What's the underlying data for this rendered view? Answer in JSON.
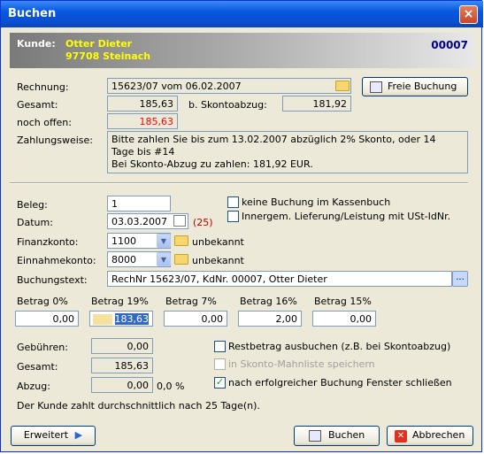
{
  "window": {
    "title": "Buchen",
    "close_symbol": "×"
  },
  "header": {
    "kunde_label": "Kunde:",
    "name": "Otter Dieter",
    "address": "97708 Steinach",
    "number": "00007"
  },
  "rechnung": {
    "label": "Rechnung:",
    "value": "15623/07 vom 06.02.2007",
    "gesamt_label": "Gesamt:",
    "gesamt": "185,63",
    "skonto_label": "b. Skontoabzug:",
    "skonto": "181,92",
    "offen_label": "noch offen:",
    "offen": "185,63",
    "zahlungsweise_label": "Zahlungsweise:",
    "zahlungsweise_line1": "Bitte zahlen Sie bis zum 13.02.2007 abzüglich 2% Skonto, oder 14",
    "zahlungsweise_line2": "Tage bis #14",
    "zahlungsweise_line3": "Bei Skonto-Abzug zu zahlen: 181,92 EUR."
  },
  "freie_buchung": "Freie Buchung",
  "beleg": {
    "label": "Beleg:",
    "value": "1"
  },
  "datum": {
    "label": "Datum:",
    "value": "03.03.2007",
    "days": "(25)"
  },
  "finanzkonto": {
    "label": "Finanzkonto:",
    "value": "1100",
    "desc": "unbekannt"
  },
  "einnahmekonto": {
    "label": "Einnahmekonto:",
    "value": "8000",
    "desc": "unbekannt"
  },
  "buchungstext": {
    "label": "Buchungstext:",
    "value": "RechNr 15623/07, KdNr. 00007, Otter Dieter",
    "more": "..."
  },
  "checkboxes": {
    "keine_buchung": "keine Buchung im Kassenbuch",
    "innergem": "Innergem. Lieferung/Leistung mit USt-IdNr.",
    "restbetrag": "Restbetrag ausbuchen (z.B. bei Skontoabzug)",
    "mahnliste": "in Skonto-Mahnliste speichern",
    "fenster": "nach erfolgreicher Buchung Fenster schließen"
  },
  "betrag": [
    {
      "label": "Betrag 0%",
      "value": "0,00"
    },
    {
      "label": "Betrag 19%",
      "value": "183,63"
    },
    {
      "label": "Betrag 7%",
      "value": "0,00"
    },
    {
      "label": "Betrag 16%",
      "value": "2,00"
    },
    {
      "label": "Betrag 15%",
      "value": "0,00"
    }
  ],
  "summary": {
    "gebuehren_label": "Gebühren:",
    "gebuehren": "0,00",
    "gesamt_label": "Gesamt:",
    "gesamt": "185,63",
    "abzug_label": "Abzug:",
    "abzug": "0,00",
    "abzug_pct": "0,0 %"
  },
  "hint": "Der Kunde zahlt durchschnittlich nach 25 Tage(n).",
  "buttons": {
    "erweitert": "Erweitert",
    "buchen": "Buchen",
    "abbrechen": "Abbrechen"
  },
  "colors": {
    "header_text": "#ffff00",
    "number": "#00008b",
    "red": "#ff0000",
    "title_blue": "#0a4fd0"
  }
}
